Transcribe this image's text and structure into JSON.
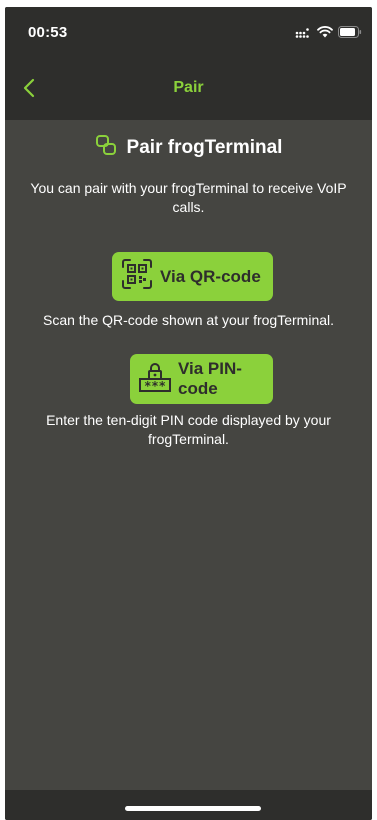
{
  "status_bar": {
    "time": "00:53",
    "icons": [
      "signal-icon",
      "wifi-icon",
      "battery-icon"
    ]
  },
  "nav": {
    "title": "Pair",
    "back_icon": "chevron-left-icon"
  },
  "main": {
    "heading": "Pair frogTerminal",
    "heading_icon": "link-icon",
    "intro": "You can pair with your frogTerminal to receive VoIP calls.",
    "qr_button": {
      "label": "Via QR-code",
      "icon": "qr-code-icon",
      "description": "Scan the QR-code shown at your frogTerminal."
    },
    "pin_button": {
      "label": "Via PIN-code",
      "icon": "pin-lock-icon",
      "description": "Enter the ten-digit PIN code displayed by your frogTerminal."
    }
  },
  "colors": {
    "accent": "#8bd13b",
    "background": "#454541",
    "bar": "#2e2e2c",
    "text": "#ffffff"
  }
}
